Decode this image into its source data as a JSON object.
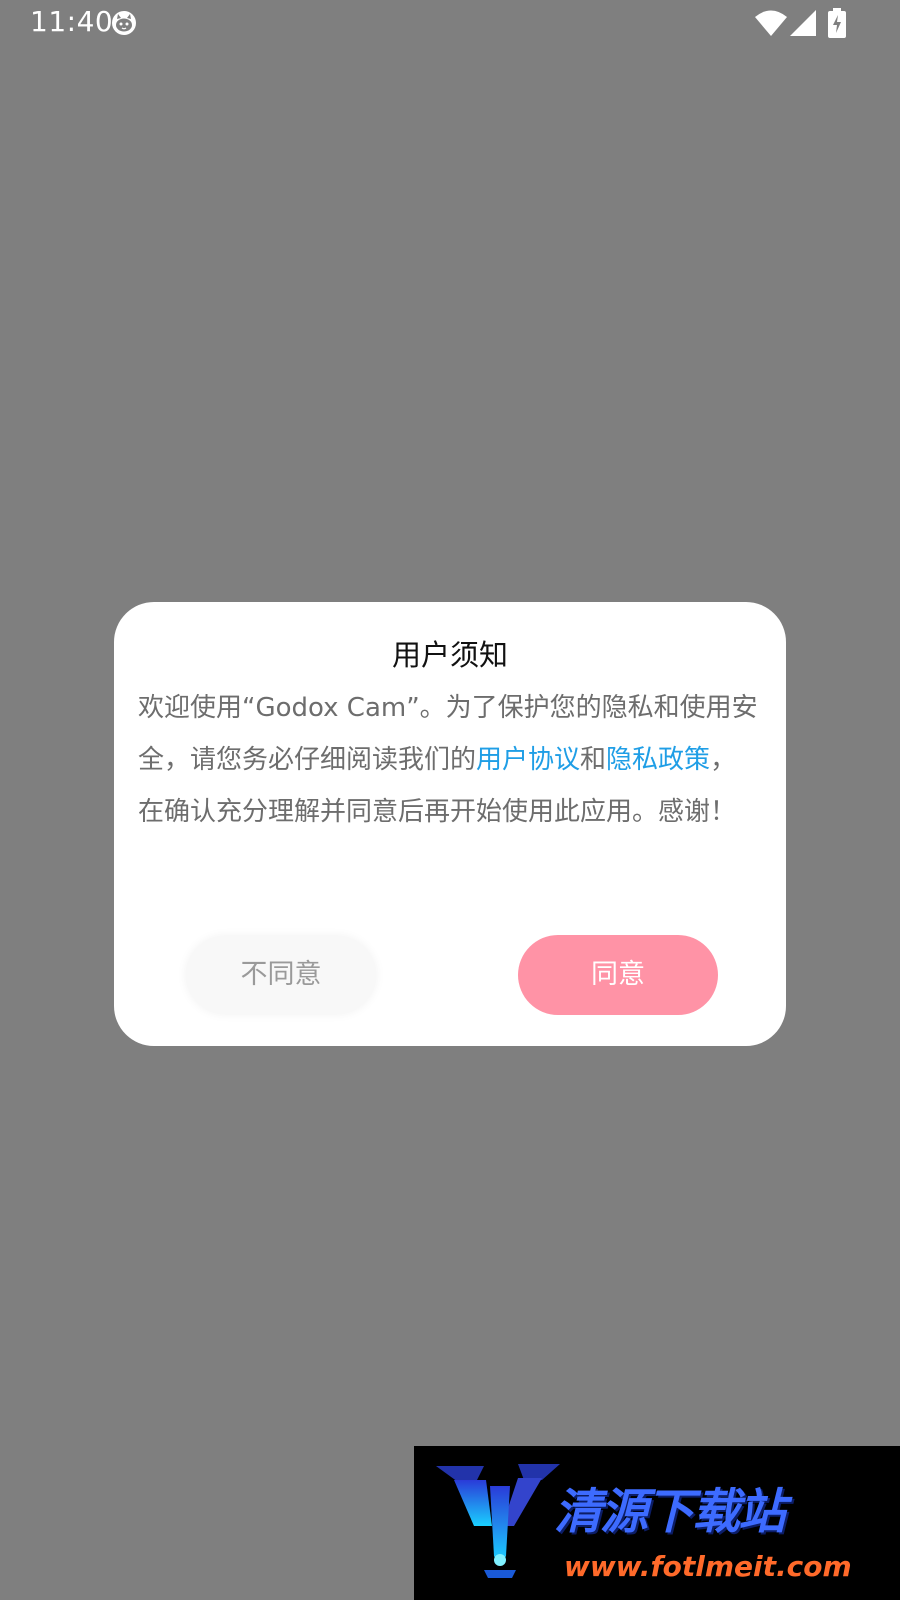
{
  "status_bar": {
    "time": "11:40",
    "icons": [
      "cat-notification-icon",
      "wifi-icon",
      "cellular-signal-icon",
      "battery-charging-icon"
    ]
  },
  "dialog": {
    "title": "用户须知",
    "body": {
      "text_1": "欢迎使用“Godox Cam”。为了保护您的隐私和使用安全，请您务必仔细阅读我们的",
      "link_user_agreement": "用户协议",
      "text_2": "和",
      "link_privacy_policy": "隐私政策",
      "text_3": "，在确认充分理解并同意后再开始使用此应用。感谢！"
    },
    "disagree_label": "不同意",
    "agree_label": "同意"
  },
  "colors": {
    "overlay": "#7f7f7f",
    "link": "#1f9ee6",
    "agree_button": "#ff93a6",
    "body_text": "#6d6d6d"
  },
  "watermark": {
    "logo_text": "清源下载站",
    "url": "www.fotlmeit.com"
  }
}
